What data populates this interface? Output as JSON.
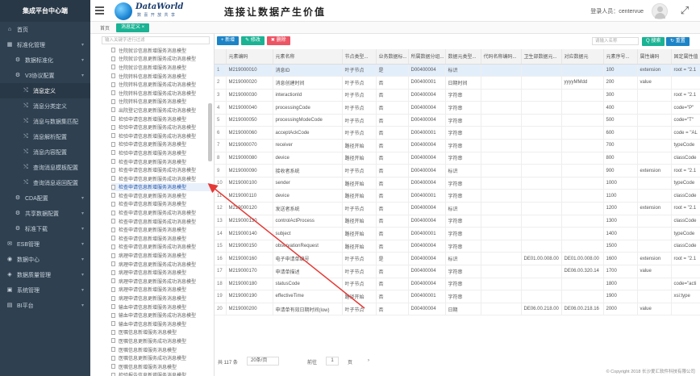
{
  "app": {
    "title": "集成平台中心端"
  },
  "header": {
    "logo_text": "DataWorld",
    "logo_sub": "数 喜 开 放 共 享",
    "slogan": "连接让数据产生价值",
    "login_user": "登录人员：centervue"
  },
  "nav": {
    "items": [
      {
        "label": "首页",
        "level": 1,
        "icon": "home-icon",
        "glyph": "⌂"
      },
      {
        "label": "标准化管理",
        "level": 1,
        "icon": "grid-icon",
        "glyph": "▦"
      },
      {
        "label": "数据标准化",
        "level": 2,
        "icon": "gear-icon",
        "glyph": "⚙"
      },
      {
        "label": "V3协议配置",
        "level": 2,
        "icon": "gear-icon",
        "glyph": "⚙"
      },
      {
        "label": "消息定义",
        "level": 3,
        "icon": "arrows-icon",
        "glyph": "⤭",
        "active": true
      },
      {
        "label": "消息分类定义",
        "level": 3,
        "icon": "arrows-icon",
        "glyph": "⤭"
      },
      {
        "label": "消息与数据集匹配",
        "level": 3,
        "icon": "arrows-icon",
        "glyph": "⤭"
      },
      {
        "label": "消息解析配置",
        "level": 3,
        "icon": "arrows-icon",
        "glyph": "⤭"
      },
      {
        "label": "消息内容配置",
        "level": 3,
        "icon": "arrows-icon",
        "glyph": "⤭"
      },
      {
        "label": "查询消息模板配置",
        "level": 3,
        "icon": "arrows-icon",
        "glyph": "⤭"
      },
      {
        "label": "查询消息返回配置",
        "level": 3,
        "icon": "arrows-icon",
        "glyph": "⤭"
      },
      {
        "label": "CDA配置",
        "level": 2,
        "icon": "gear-icon",
        "glyph": "⚙"
      },
      {
        "label": "共享数据配置",
        "level": 2,
        "icon": "gear-icon",
        "glyph": "⚙"
      },
      {
        "label": "标准下载",
        "level": 2,
        "icon": "gear-icon",
        "glyph": "⚙"
      },
      {
        "label": "ESB管理",
        "level": 1,
        "icon": "esb-icon",
        "glyph": "✉"
      },
      {
        "label": "数据中心",
        "level": 1,
        "icon": "database-icon",
        "glyph": "◉"
      },
      {
        "label": "数据质量管理",
        "level": 1,
        "icon": "quality-icon",
        "glyph": "◈"
      },
      {
        "label": "系统管理",
        "level": 1,
        "icon": "system-icon",
        "glyph": "▣"
      },
      {
        "label": "BI平台",
        "level": 1,
        "icon": "bi-icon",
        "glyph": "▤"
      }
    ]
  },
  "tabs": {
    "home": "首页",
    "active": "消息定义 ×"
  },
  "tree": {
    "search_placeholder": "输入关键字进行过滤",
    "nodes": [
      "住院就诊信息新增服务消息模型",
      "住院就诊信息更新服务成功消息模型",
      "住院就诊信息新增服务消息模型",
      "住院转科信息新增服务消息模型",
      "住院转科信息更新服务成功消息模型",
      "住院转科信息新增服务成功消息模型",
      "住院转科信息更新服务消息模型",
      "出院登记信息更新服务成功消息模型",
      "检验申请信息新增服务消息模型",
      "检验申请信息更新服务成功消息模型",
      "检验申请信息新增服务成功消息模型",
      "检验申请信息更新服务消息模型",
      "检验申请信息新增服务消息模型",
      "检查申请信息更新服务消息模型",
      "检查申请信息新增服务成功消息模型",
      "检查申请信息更新服务成功消息模型",
      "检查申请信息新增服务消息模型",
      "检查申请信息更新服务消息模型",
      "检查申请信息新增服务消息模型",
      "检查申请信息更新服务成功消息模型",
      "检查申请信息新增服务成功消息模型",
      "检查申请信息更新服务消息模型",
      "检查申请信息新增服务消息模型",
      "检查申请信息更新服务成功消息模型",
      "病理申请信息新增服务消息模型",
      "病理申请信息更新服务成功消息模型",
      "病理申请信息新增服务消息模型",
      "病理申请信息更新服务成功消息模型",
      "病理申请信息新增服务消息模型",
      "病理申请信息更新服务消息模型",
      "输血申请信息新增服务消息模型",
      "输血申请信息更新服务成功消息模型",
      "输血申请信息新增服务消息模型",
      "医嘱信息新增服务消息模型",
      "医嘱信息更新服务成功消息模型",
      "医嘱信息新增服务消息模型",
      "医嘱信息更新服务成功消息模型",
      "医嘱信息新增服务消息模型",
      "检验报告信息新增服务消息模型",
      "检验报告信息更新服务成功消息模型"
    ],
    "selected_index": 16
  },
  "toolbar": {
    "add_label": "+ 新增",
    "edit_label": "✎ 修改",
    "delete_label": "✖ 删除",
    "search_placeholder": "请输入名称",
    "search_label": "Q 搜索",
    "reset_label": "↻ 重置"
  },
  "table": {
    "columns": [
      "",
      "元素编码",
      "元素名称",
      "节点类型...",
      "业务数据标...",
      "所属数据分组...",
      "数据元类型...",
      "代码名称编码...",
      "卫生部数据元...",
      "对应数据元",
      "元素序号...",
      "属性编码",
      "固定属性值"
    ],
    "rows": [
      [
        "1",
        "M219000010",
        "消息ID",
        "叶子节点",
        "是",
        "D00400004",
        "标识",
        "",
        "",
        "",
        "100",
        "extension",
        "root = \"2.1"
      ],
      [
        "2",
        "M219000020",
        "消息创建时间",
        "叶子节点",
        "否",
        "D00400001",
        "日期时间",
        "",
        "",
        "yyyyMMdd",
        "200",
        "value",
        ""
      ],
      [
        "3",
        "M219000030",
        "interactionId",
        "叶子节点",
        "否",
        "D00400004",
        "字符串",
        "",
        "",
        "",
        "300",
        "",
        "root = \"2.1"
      ],
      [
        "4",
        "M219000040",
        "processingCode",
        "叶子节点",
        "否",
        "D00400004",
        "字符串",
        "",
        "",
        "",
        "400",
        "",
        "code=\"P\""
      ],
      [
        "5",
        "M219000050",
        "processingModeCode",
        "叶子节点",
        "否",
        "D00400004",
        "字符串",
        "",
        "",
        "",
        "500",
        "",
        "code=\"T\""
      ],
      [
        "6",
        "M219000060",
        "acceptAckCode",
        "叶子节点",
        "否",
        "D00400001",
        "字符串",
        "",
        "",
        "",
        "600",
        "",
        "code = \"AL"
      ],
      [
        "7",
        "M219000070",
        "receiver",
        "路径开始",
        "否",
        "D00400004",
        "字符串",
        "",
        "",
        "",
        "700",
        "",
        "typeCode"
      ],
      [
        "8",
        "M219000080",
        "device",
        "路径开始",
        "否",
        "D00400004",
        "字符串",
        "",
        "",
        "",
        "800",
        "",
        "classCode"
      ],
      [
        "9",
        "M219000090",
        "接收者系统",
        "叶子节点",
        "否",
        "D00400004",
        "标识",
        "",
        "",
        "",
        "900",
        "extension",
        "root = \"2.1"
      ],
      [
        "10",
        "M219000100",
        "sender",
        "路径开始",
        "否",
        "D00400004",
        "字符串",
        "",
        "",
        "",
        "1000",
        "",
        "typeCode"
      ],
      [
        "11",
        "M219000110",
        "device",
        "路径开始",
        "否",
        "D00400001",
        "字符串",
        "",
        "",
        "",
        "1100",
        "",
        "classCode"
      ],
      [
        "12",
        "M219000120",
        "发送者系统",
        "叶子节点",
        "否",
        "D00400004",
        "标识",
        "",
        "",
        "",
        "1200",
        "extension",
        "root = \"2.1"
      ],
      [
        "13",
        "M219000130",
        "controlActProcess",
        "路径开始",
        "否",
        "D00400004",
        "字符串",
        "",
        "",
        "",
        "1300",
        "",
        "classCode"
      ],
      [
        "14",
        "M219000140",
        "subject",
        "路径开始",
        "否",
        "D00400001",
        "字符串",
        "",
        "",
        "",
        "1400",
        "",
        "typeCode"
      ],
      [
        "15",
        "M219000150",
        "observationRequest",
        "路径开始",
        "否",
        "D00400004",
        "字符串",
        "",
        "",
        "",
        "1500",
        "",
        "classCode"
      ],
      [
        "16",
        "M219000160",
        "电子申请单编号",
        "叶子节点",
        "是",
        "D00400004",
        "标识",
        "",
        "DE01.00.008.00",
        "DE01.00.008.00",
        "1600",
        "extension",
        "root = \"2.1"
      ],
      [
        "17",
        "M219000170",
        "申请单描述",
        "叶子节点",
        "否",
        "D00400004",
        "字符串",
        "",
        "",
        "DE06.00.320.14",
        "1700",
        "value",
        ""
      ],
      [
        "18",
        "M219000180",
        "statusCode",
        "叶子节点",
        "否",
        "D00400004",
        "字符串",
        "",
        "",
        "",
        "1800",
        "",
        "code=\"acti"
      ],
      [
        "19",
        "M219000190",
        "effectiveTime",
        "路径开始",
        "否",
        "D00400001",
        "字符串",
        "",
        "",
        "",
        "1900",
        "",
        "xsi:type"
      ],
      [
        "20",
        "M219000200",
        "申请单有效日期时间(low)",
        "叶子节点",
        "否",
        "D00400004",
        "日期",
        "",
        "DE06.00.218.00",
        "DE06.00.218.16",
        "2000",
        "value",
        ""
      ]
    ],
    "highlight_row": 0
  },
  "pager": {
    "total": "共 117 条",
    "page_size": "20条/页",
    "prev": "前往",
    "page": "1",
    "of": "页",
    "next": "›"
  },
  "footer": {
    "copyright": "© Copyright 2018 长沙爱汇软件科技有限公司"
  },
  "colors": {
    "sidebar": "#2f4050",
    "accent_green": "#1ab394",
    "accent_blue": "#1c84c6",
    "accent_red": "#ed5565",
    "annotation_arrow": "#e53935"
  }
}
